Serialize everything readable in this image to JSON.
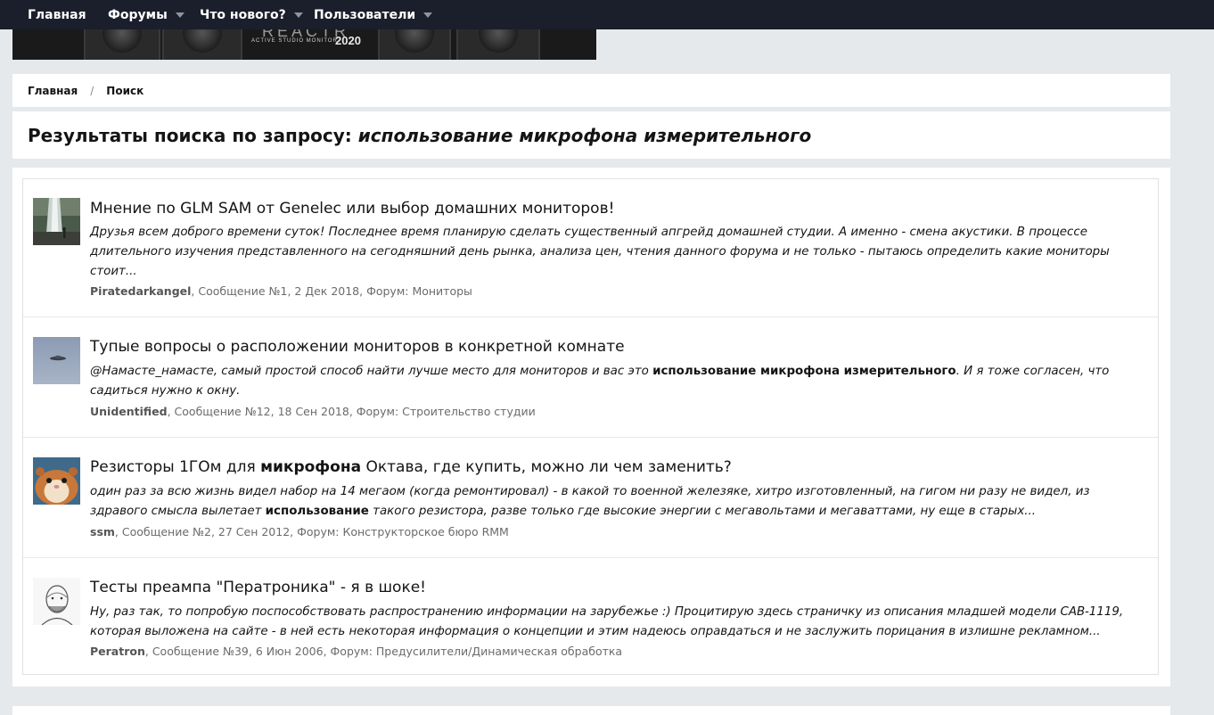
{
  "nav": {
    "items": [
      {
        "label": "Главная",
        "dropdown": false
      },
      {
        "label": "Форумы",
        "dropdown": true
      },
      {
        "label": "Что нового?",
        "dropdown": true
      },
      {
        "label": "Пользователи",
        "dropdown": true
      }
    ]
  },
  "banner": {
    "brand": "REACTR",
    "subtitle": "ACTIVE STUDIO MONITOR",
    "year": "2020"
  },
  "breadcrumb": {
    "items": [
      "Главная",
      "Поиск"
    ],
    "separator": "/"
  },
  "page": {
    "title_prefix": "Результаты поиска по запросу:",
    "query": "использование микрофона измерительного"
  },
  "results": [
    {
      "title": "Мнение по GLM SAM от Genelec или выбор домашних мониторов!",
      "snippet_line1": "Друзья всем доброго времени суток! Последнее время планирую сделать существенный апгрейд домашней студии. А именно - смена акустики. В процессе",
      "snippet_line2": "длительного изучения представленного на сегодняшний день рынка, анализа цен, чтения данного форума и не только - пытаюсь определить какие мониторы",
      "snippet_line3": "стоит...",
      "author": "Piratedarkangel",
      "meta": ", Сообщение №1, 2 Дек 2018, Форум: ",
      "forum": "Мониторы",
      "avatar": "waterfall-photo"
    },
    {
      "title": "Тупые вопросы о расположении мониторов в конкретной комнате",
      "snippet_line1_a": "@Намасте_намасте, самый простой способ найти лучше место для мониторов и вас это ",
      "snippet_line1_b": "использование микрофона измерительного",
      "snippet_line1_c": ". И я тоже согласен, что",
      "snippet_line2": "садиться нужно к окну.",
      "author": "Unidentified",
      "meta": ", Сообщение №12, 18 Сен 2018, Форум: ",
      "forum": "Строительство студии",
      "avatar": "ufo-sky-photo"
    },
    {
      "title_a": "Резисторы 1ГОм для ",
      "title_b": "микрофона",
      "title_c": " Октава, где купить, можно ли чем заменить?",
      "snippet_line1": "один раз за всю жизнь видел набор на 14 мегаом (когда ремонтировал) - в какой то военной железяке, хитро изготовленный, на гигом ни разу не видел, из",
      "snippet_line2_a": "здравого смысла вылетает ",
      "snippet_line2_b": "использование",
      "snippet_line2_c": " такого резистора, разве только где высокие энергии с мегавольтами и мегаваттами, ну еще в старых...",
      "author": "ssm",
      "meta": ", Сообщение №2, 27 Сен 2012, Форум: ",
      "forum": "Конструкторское бюро RMM",
      "avatar": "hamster-photo"
    },
    {
      "title": "Тесты преампа \"Ператроника\" - я в шоке!",
      "snippet_line1": "Ну, раз так, то попробую поспособствовать распространению информации на зарубежье :) Процитирую здесь страничку из описания младшей модели CAB-1119,",
      "snippet_line2": "которая выложена на сайте - в ней есть некоторая информация о концепции и этим надеюсь оправдаться и не заслужить порицания в излишне рекламном...",
      "author": "Peratron",
      "meta": ", Сообщение №39, 6 Июн 2006, Форум: ",
      "forum": "Предусилители/Динамическая обработка",
      "avatar": "sketch-portrait"
    }
  ]
}
